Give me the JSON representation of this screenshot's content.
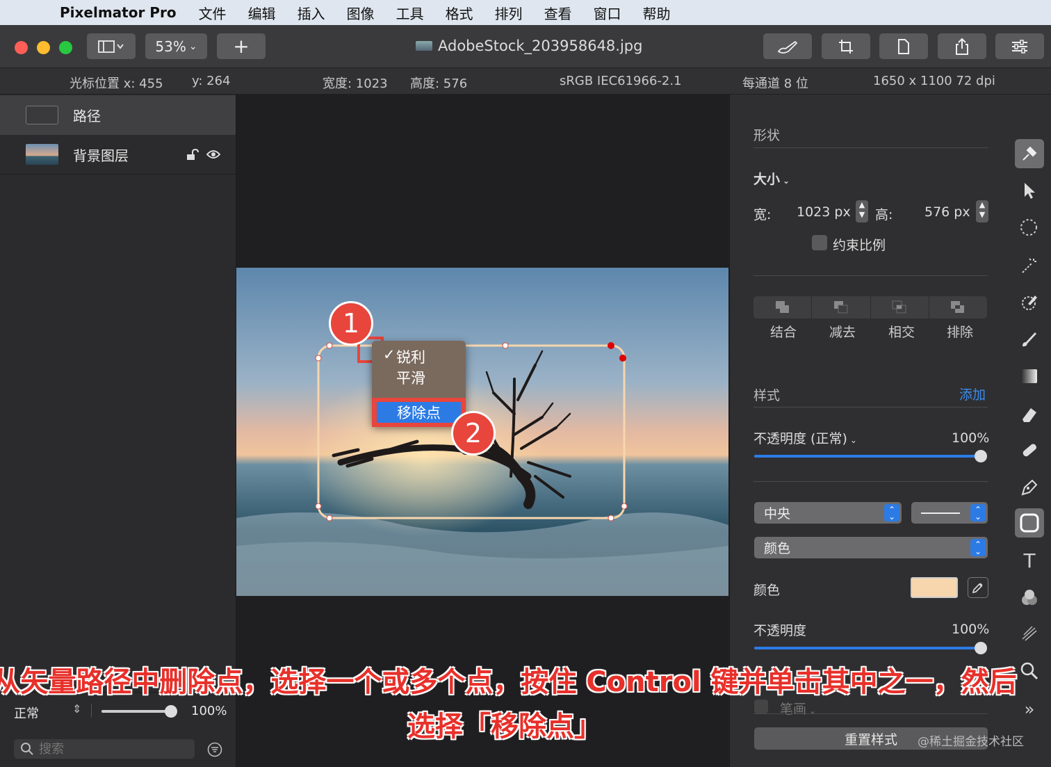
{
  "menubar": {
    "app_name": "Pixelmator Pro",
    "items": [
      "文件",
      "编辑",
      "插入",
      "图像",
      "工具",
      "格式",
      "排列",
      "查看",
      "窗口",
      "帮助"
    ]
  },
  "toolbar": {
    "zoom": "53%",
    "add_label": "+",
    "doc_title": "AdobeStock_203958648.jpg"
  },
  "infobar": {
    "cursor_x_label": "光标位置 x: 455",
    "cursor_y_label": "y: 264",
    "width_label": "宽度: 1023",
    "height_label": "高度: 576",
    "profile": "sRGB IEC61966-2.1",
    "depth": "每通道 8 位",
    "image_size": "1650 x 1100 72 dpi"
  },
  "layers": [
    {
      "name": "路径"
    },
    {
      "name": "背景图层"
    }
  ],
  "sidebar_bottom": {
    "blend_mode": "正常",
    "opacity": "100%",
    "opacity_fraction": 1.0,
    "search_placeholder": "搜索"
  },
  "context_menu": {
    "items": [
      "锐利",
      "平滑"
    ],
    "checked": "锐利",
    "remove_point": "移除点"
  },
  "badges": {
    "one": "1",
    "two": "2"
  },
  "panel": {
    "shape_heading": "形状",
    "size_label": "大小",
    "width_label": "宽:",
    "width_value": "1023 px",
    "height_label": "高:",
    "height_value": "576 px",
    "constrain": "约束比例",
    "bool_ops": [
      "结合",
      "减去",
      "相交",
      "排除"
    ],
    "style_heading": "样式",
    "add_label": "添加",
    "opacity_mode_label": "不透明度 (正常)",
    "opacity_value": "100%",
    "opacity_fraction": 1.0,
    "stroke_position": "中央",
    "fill_type": "颜色",
    "color_label": "颜色",
    "color_value": "#f7d6ae",
    "opacity2_label": "不透明度",
    "opacity2_value": "100%",
    "opacity2_fraction": 1.0,
    "stroke_label": "笔画",
    "reset_label": "重置样式"
  },
  "caption": {
    "line1": "从矢量路径中删除点，选择一个或多个点，按住 Control 键并单击其中之一，然后",
    "line2": "选择「移除点」"
  },
  "watermark": "@稀土掘金技术社区",
  "colors": {
    "accent": "#2c7be5",
    "badge": "#e8453c",
    "caption": "#e8302a"
  }
}
